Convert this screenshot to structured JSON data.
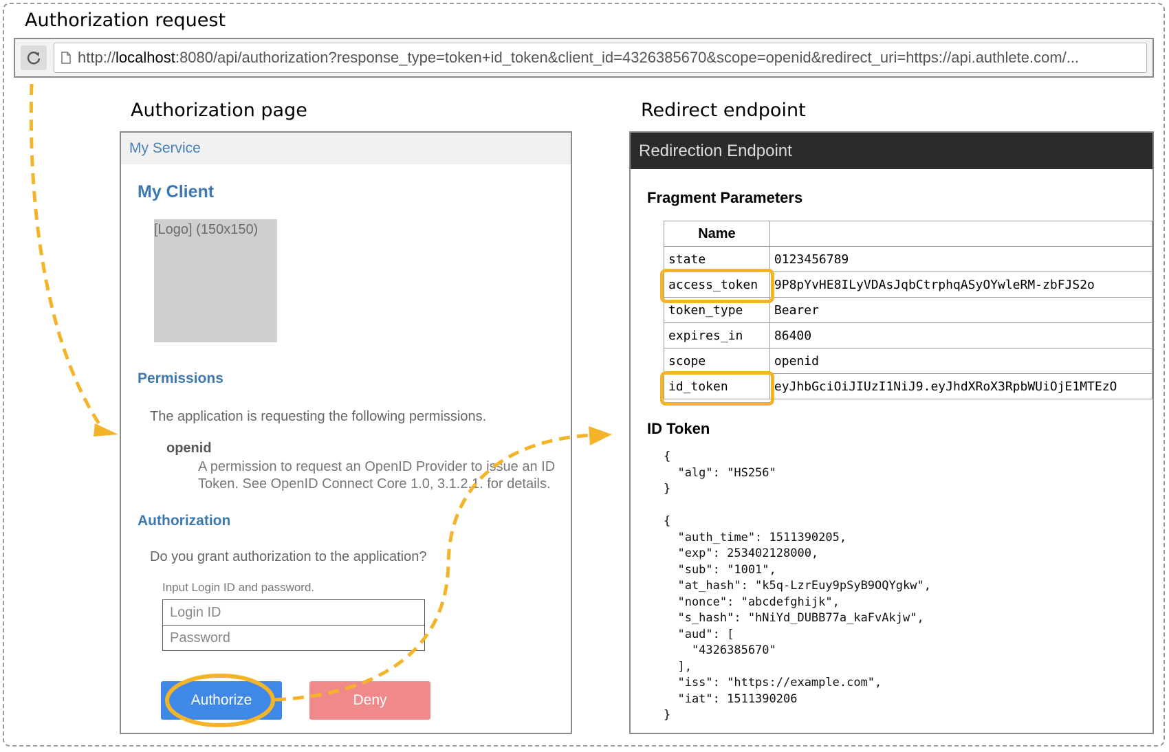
{
  "labels": {
    "authorization_request": "Authorization request",
    "authorization_page": "Authorization page",
    "redirect_endpoint": "Redirect endpoint"
  },
  "browser": {
    "url_prefix": "http://",
    "url_host": "localhost",
    "url_rest": ":8080/api/authorization?response_type=token+id_token&client_id=4326385670&scope=openid&redirect_uri=https://api.authlete.com/..."
  },
  "auth_page": {
    "service": "My Service",
    "client": "My Client",
    "logo": "[Logo] (150x150)",
    "permissions_heading": "Permissions",
    "permissions_text": "The application is requesting the following permissions.",
    "scope_name": "openid",
    "scope_desc": "A permission to request an OpenID Provider to issue an ID Token. See OpenID Connect Core 1.0, 3.1.2.1. for details.",
    "authorization_heading": "Authorization",
    "authorization_question": "Do you grant authorization to the application?",
    "login_hint": "Input Login ID and password.",
    "login_placeholder": "Login ID",
    "password_placeholder": "Password",
    "authorize_label": "Authorize",
    "deny_label": "Deny"
  },
  "redirect_page": {
    "title": "Redirection Endpoint",
    "fragment_heading": "Fragment Parameters",
    "name_header": "Name",
    "params": [
      {
        "name": "state",
        "value": "0123456789"
      },
      {
        "name": "access_token",
        "value": "9P8pYvHE8ILyVDAsJqbCtrphqASyOYwleRM-zbFJS2o"
      },
      {
        "name": "token_type",
        "value": "Bearer"
      },
      {
        "name": "expires_in",
        "value": "86400"
      },
      {
        "name": "scope",
        "value": "openid"
      },
      {
        "name": "id_token",
        "value": "eyJhbGciOiJIUzI1NiJ9.eyJhdXRoX3RpbWUiOjE1MTEzO"
      }
    ],
    "id_token_heading": "ID Token",
    "id_token_json": "{\n  \"alg\": \"HS256\"\n}\n\n{\n  \"auth_time\": 1511390205,\n  \"exp\": 253402128000,\n  \"sub\": \"1001\",\n  \"at_hash\": \"k5q-LzrEuy9pSyB9OQYgkw\",\n  \"nonce\": \"abcdefghijk\",\n  \"s_hash\": \"hNiYd_DUBB77a_kaFvAkjw\",\n  \"aud\": [\n    \"4326385670\"\n  ],\n  \"iss\": \"https://example.com\",\n  \"iat\": 1511390206\n}"
  },
  "colors": {
    "highlight": "#f4b42a",
    "link_blue": "#3c78b0",
    "authorize_bg": "#3f88e8",
    "deny_bg": "#f08a8a"
  }
}
